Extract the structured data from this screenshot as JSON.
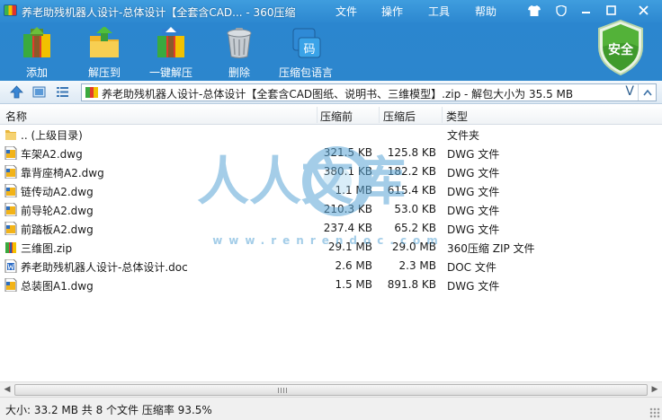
{
  "window": {
    "title": "养老助残机器人设计-总体设计【全套含CAD... - 360压缩",
    "menu": [
      "文件",
      "操作",
      "工具",
      "帮助"
    ]
  },
  "toolbar": {
    "buttons": [
      {
        "label": "添加",
        "icon": "add-archive-icon"
      },
      {
        "label": "解压到",
        "icon": "extract-to-icon"
      },
      {
        "label": "一键解压",
        "icon": "one-click-extract-icon"
      },
      {
        "label": "删除",
        "icon": "delete-trash-icon"
      },
      {
        "label": "压缩包语言",
        "icon": "archive-language-icon"
      }
    ],
    "security_badge": "安全",
    "language_icon_text": "码"
  },
  "address": {
    "path": "养老助残机器人设计-总体设计【全套含CAD图纸、说明书、三维模型】.zip - 解包大小为 35.5 MB",
    "dropdown_glyph": "V"
  },
  "columns": {
    "name": "名称",
    "compressed_before": "压缩前",
    "compressed_after": "压缩后",
    "type": "类型"
  },
  "files": [
    {
      "name": ".. (上级目录)",
      "before": "",
      "after": "",
      "type": "文件夹",
      "icon": "folder-icon"
    },
    {
      "name": "车架A2.dwg",
      "before": "321.5 KB",
      "after": "125.8 KB",
      "type": "DWG 文件",
      "icon": "dwg-file-icon"
    },
    {
      "name": "靠背座椅A2.dwg",
      "before": "380.1 KB",
      "after": "182.2 KB",
      "type": "DWG 文件",
      "icon": "dwg-file-icon"
    },
    {
      "name": "链传动A2.dwg",
      "before": "1.1 MB",
      "after": "615.4 KB",
      "type": "DWG 文件",
      "icon": "dwg-file-icon"
    },
    {
      "name": "前导轮A2.dwg",
      "before": "210.3 KB",
      "after": "53.0 KB",
      "type": "DWG 文件",
      "icon": "dwg-file-icon"
    },
    {
      "name": "前踏板A2.dwg",
      "before": "237.4 KB",
      "after": "65.2 KB",
      "type": "DWG 文件",
      "icon": "dwg-file-icon"
    },
    {
      "name": "三维图.zip",
      "before": "29.1 MB",
      "after": "29.0 MB",
      "type": "360压缩 ZIP 文件",
      "icon": "zip-file-icon"
    },
    {
      "name": "养老助残机器人设计-总体设计.doc",
      "before": "2.6 MB",
      "after": "2.3 MB",
      "type": "DOC 文件",
      "icon": "doc-file-icon"
    },
    {
      "name": "总装图A1.dwg",
      "before": "1.5 MB",
      "after": "891.8 KB",
      "type": "DWG 文件",
      "icon": "dwg-file-icon"
    }
  ],
  "watermark": {
    "text": "人人文库",
    "url": "www.renrendoc.com"
  },
  "status": {
    "text": "大小: 33.2 MB 共 8 个文件 压缩率 93.5%"
  },
  "colors": {
    "header": "#2c86cd",
    "shield": "#3f9a2c",
    "watermark": "#5aa6d6"
  }
}
